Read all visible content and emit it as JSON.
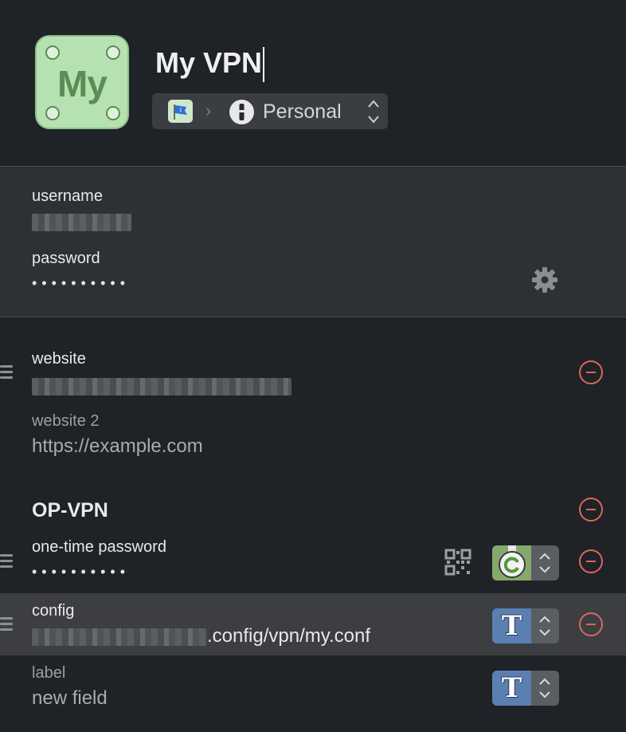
{
  "header": {
    "app_icon_text": "My",
    "title": "My VPN",
    "vault": {
      "label": "Personal"
    }
  },
  "login": {
    "username_label": "username",
    "password_label": "password",
    "password_value": "••••••••••"
  },
  "websites": [
    {
      "label": "website",
      "value": ""
    },
    {
      "label": "website 2",
      "value": "https://example.com"
    }
  ],
  "section": {
    "title": "OP-VPN",
    "otp_label": "one-time password",
    "otp_value": "••••••••••",
    "config_label": "config",
    "config_value": ".config/vpn/my.conf",
    "new_label": "label",
    "new_placeholder": "new field"
  },
  "colors": {
    "background": "#1f2226",
    "login_block": "#2d3034",
    "remove_red": "#d9685c",
    "text_type_blue": "#5c7fb1",
    "otp_green": "#84a96c",
    "icon_green": "#b6e2b1"
  }
}
